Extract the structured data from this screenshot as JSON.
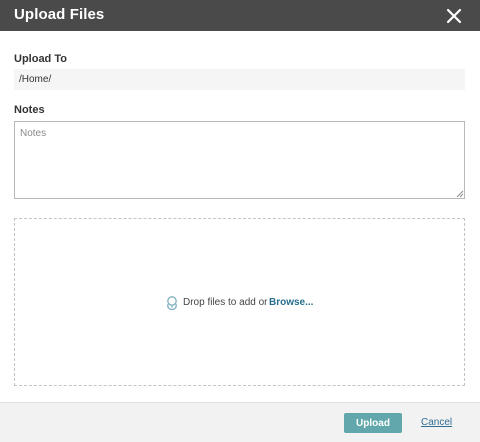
{
  "dialog": {
    "title": "Upload Files",
    "close_icon": "close-icon"
  },
  "upload_to": {
    "label": "Upload To",
    "path": "/Home/"
  },
  "notes": {
    "label": "Notes",
    "placeholder": "Notes",
    "value": ""
  },
  "dropzone": {
    "icon": "upload-cloud-icon",
    "text": "Drop files to add or",
    "browse_label": "Browse..."
  },
  "footer": {
    "upload_label": "Upload",
    "cancel_label": "Cancel"
  },
  "colors": {
    "titlebar": "#4a4a4a",
    "upload_button": "#62a7ab",
    "link": "#2a6f8f"
  }
}
